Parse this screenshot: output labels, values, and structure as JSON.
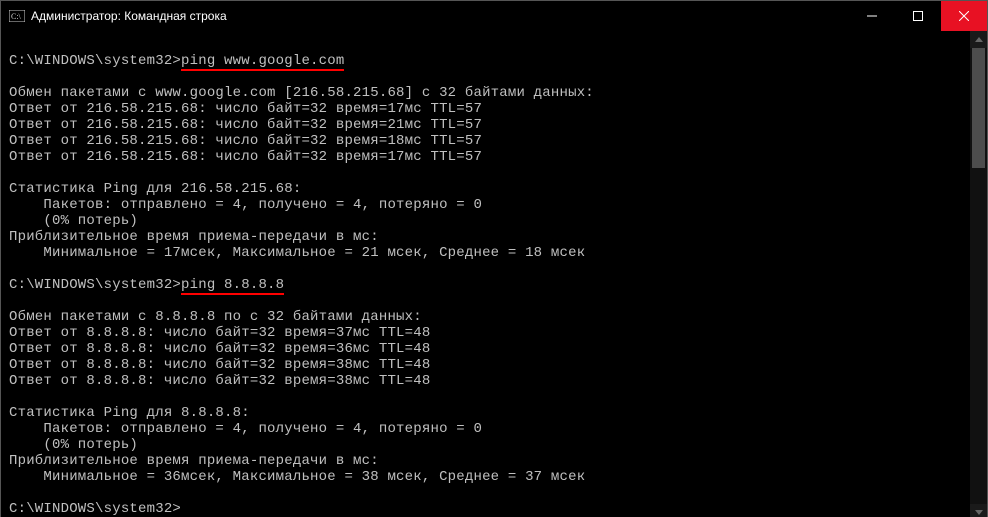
{
  "titlebar": {
    "title": "Администратор: Командная строка"
  },
  "session": {
    "prompt": "C:\\WINDOWS\\system32>",
    "cmd1": "ping www.google.com",
    "block1": {
      "l1": "Обмен пакетами с www.google.com [216.58.215.68] с 32 байтами данных:",
      "l2": "Ответ от 216.58.215.68: число байт=32 время=17мс TTL=57",
      "l3": "Ответ от 216.58.215.68: число байт=32 время=21мс TTL=57",
      "l4": "Ответ от 216.58.215.68: число байт=32 время=18мс TTL=57",
      "l5": "Ответ от 216.58.215.68: число байт=32 время=17мс TTL=57",
      "s1": "Статистика Ping для 216.58.215.68:",
      "s2": "    Пакетов: отправлено = 4, получено = 4, потеряно = 0",
      "s3": "    (0% потерь)",
      "s4": "Приблизительное время приема-передачи в мс:",
      "s5": "    Минимальное = 17мсек, Максимальное = 21 мсек, Среднее = 18 мсек"
    },
    "cmd2": "ping 8.8.8.8",
    "block2": {
      "l1": "Обмен пакетами с 8.8.8.8 по с 32 байтами данных:",
      "l2": "Ответ от 8.8.8.8: число байт=32 время=37мс TTL=48",
      "l3": "Ответ от 8.8.8.8: число байт=32 время=36мс TTL=48",
      "l4": "Ответ от 8.8.8.8: число байт=32 время=38мс TTL=48",
      "l5": "Ответ от 8.8.8.8: число байт=32 время=38мс TTL=48",
      "s1": "Статистика Ping для 8.8.8.8:",
      "s2": "    Пакетов: отправлено = 4, получено = 4, потеряно = 0",
      "s3": "    (0% потерь)",
      "s4": "Приблизительное время приема-передачи в мс:",
      "s5": "    Минимальное = 36мсек, Максимальное = 38 мсек, Среднее = 37 мсек"
    }
  }
}
